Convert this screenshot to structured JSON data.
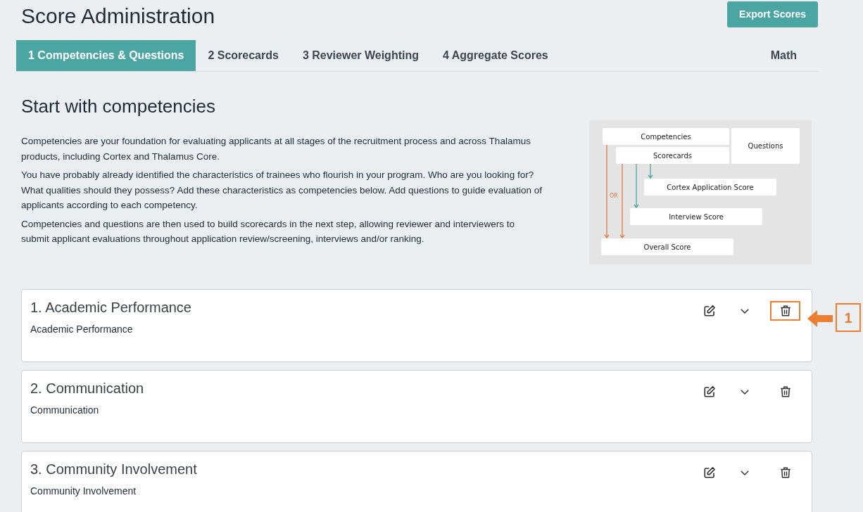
{
  "header": {
    "title": "Score Administration",
    "export_button": "Export Scores"
  },
  "tabs": [
    {
      "label": "1 Competencies & Questions",
      "selected": true,
      "kind": "step"
    },
    {
      "label": "2 Scorecards",
      "selected": false,
      "kind": "step"
    },
    {
      "label": "3 Reviewer Weighting",
      "selected": false,
      "kind": "step"
    },
    {
      "label": "4 Aggregate Scores",
      "selected": false,
      "kind": "step"
    },
    {
      "label": "Math",
      "selected": false,
      "kind": "extra"
    }
  ],
  "intro": {
    "heading": "Start with competencies",
    "paragraphs": [
      "Competencies are your foundation for evaluating applicants at all stages of the recruitment process and across Thalamus products, including Cortex and Thalamus Core.",
      "You have probably already identified the characteristics of trainees who flourish in your program. Who are you looking for? What qualities should they possess? Add these characteristics as competencies below. Add questions to guide evaluation of applicants according to each competency.",
      "Competencies and questions are then used to build scorecards in the next step, allowing reviewer and interviewers to submit applicant evaluations throughout application review/screening, interviews and/or ranking."
    ]
  },
  "diagram": {
    "boxes": [
      "Competencies",
      "Questions",
      "Scorecards",
      "Cortex Application Score",
      "Interview Score",
      "Overall Score"
    ],
    "or_label": "OR"
  },
  "competencies": [
    {
      "title": "1. Academic Performance",
      "description": "Academic Performance",
      "delete_highlighted": true
    },
    {
      "title": "2. Communication",
      "description": "Communication",
      "delete_highlighted": false
    },
    {
      "title": "3. Community Involvement",
      "description": "Community Involvement",
      "delete_highlighted": false
    }
  ],
  "callout": {
    "number": "1"
  }
}
